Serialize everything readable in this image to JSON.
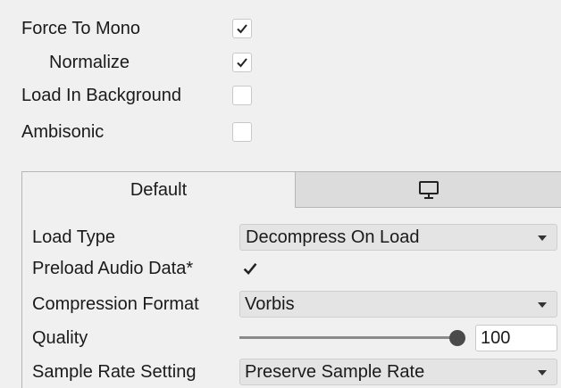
{
  "options": {
    "force_to_mono": {
      "label": "Force To Mono",
      "checked": true
    },
    "normalize": {
      "label": "Normalize",
      "checked": true
    },
    "load_in_background": {
      "label": "Load In Background",
      "checked": false
    },
    "ambisonic": {
      "label": "Ambisonic",
      "checked": false
    }
  },
  "tabs": {
    "default": {
      "label": "Default"
    },
    "standalone": {
      "icon": "monitor-icon"
    }
  },
  "settings": {
    "load_type": {
      "label": "Load Type",
      "value": "Decompress On Load"
    },
    "preload_audio_data": {
      "label": "Preload Audio Data*",
      "checked": true
    },
    "compression_format": {
      "label": "Compression Format",
      "value": "Vorbis"
    },
    "quality": {
      "label": "Quality",
      "value": "100",
      "slider_fraction": 1.0
    },
    "sample_rate_setting": {
      "label": "Sample Rate Setting",
      "value": "Preserve Sample Rate"
    }
  },
  "colors": {
    "background": "#f0f0f0",
    "inactive_tab": "#dcdcdc",
    "dropdown_bg": "#e4e4e4"
  }
}
